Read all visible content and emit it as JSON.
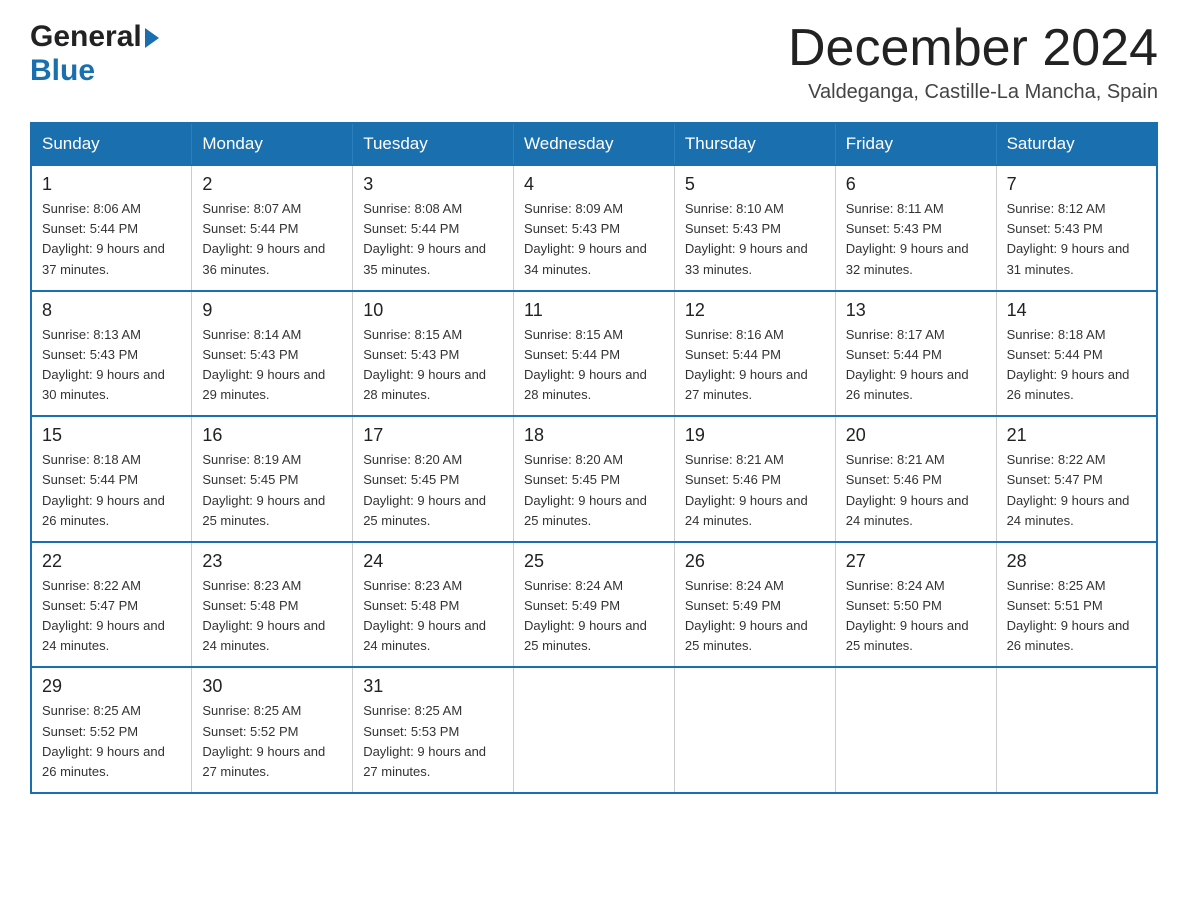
{
  "header": {
    "logo_general": "General",
    "logo_blue": "Blue",
    "month_title": "December 2024",
    "subtitle": "Valdeganga, Castille-La Mancha, Spain"
  },
  "weekdays": [
    "Sunday",
    "Monday",
    "Tuesday",
    "Wednesday",
    "Thursday",
    "Friday",
    "Saturday"
  ],
  "weeks": [
    [
      {
        "day": "1",
        "sunrise": "8:06 AM",
        "sunset": "5:44 PM",
        "daylight": "9 hours and 37 minutes."
      },
      {
        "day": "2",
        "sunrise": "8:07 AM",
        "sunset": "5:44 PM",
        "daylight": "9 hours and 36 minutes."
      },
      {
        "day": "3",
        "sunrise": "8:08 AM",
        "sunset": "5:44 PM",
        "daylight": "9 hours and 35 minutes."
      },
      {
        "day": "4",
        "sunrise": "8:09 AM",
        "sunset": "5:43 PM",
        "daylight": "9 hours and 34 minutes."
      },
      {
        "day": "5",
        "sunrise": "8:10 AM",
        "sunset": "5:43 PM",
        "daylight": "9 hours and 33 minutes."
      },
      {
        "day": "6",
        "sunrise": "8:11 AM",
        "sunset": "5:43 PM",
        "daylight": "9 hours and 32 minutes."
      },
      {
        "day": "7",
        "sunrise": "8:12 AM",
        "sunset": "5:43 PM",
        "daylight": "9 hours and 31 minutes."
      }
    ],
    [
      {
        "day": "8",
        "sunrise": "8:13 AM",
        "sunset": "5:43 PM",
        "daylight": "9 hours and 30 minutes."
      },
      {
        "day": "9",
        "sunrise": "8:14 AM",
        "sunset": "5:43 PM",
        "daylight": "9 hours and 29 minutes."
      },
      {
        "day": "10",
        "sunrise": "8:15 AM",
        "sunset": "5:43 PM",
        "daylight": "9 hours and 28 minutes."
      },
      {
        "day": "11",
        "sunrise": "8:15 AM",
        "sunset": "5:44 PM",
        "daylight": "9 hours and 28 minutes."
      },
      {
        "day": "12",
        "sunrise": "8:16 AM",
        "sunset": "5:44 PM",
        "daylight": "9 hours and 27 minutes."
      },
      {
        "day": "13",
        "sunrise": "8:17 AM",
        "sunset": "5:44 PM",
        "daylight": "9 hours and 26 minutes."
      },
      {
        "day": "14",
        "sunrise": "8:18 AM",
        "sunset": "5:44 PM",
        "daylight": "9 hours and 26 minutes."
      }
    ],
    [
      {
        "day": "15",
        "sunrise": "8:18 AM",
        "sunset": "5:44 PM",
        "daylight": "9 hours and 26 minutes."
      },
      {
        "day": "16",
        "sunrise": "8:19 AM",
        "sunset": "5:45 PM",
        "daylight": "9 hours and 25 minutes."
      },
      {
        "day": "17",
        "sunrise": "8:20 AM",
        "sunset": "5:45 PM",
        "daylight": "9 hours and 25 minutes."
      },
      {
        "day": "18",
        "sunrise": "8:20 AM",
        "sunset": "5:45 PM",
        "daylight": "9 hours and 25 minutes."
      },
      {
        "day": "19",
        "sunrise": "8:21 AM",
        "sunset": "5:46 PM",
        "daylight": "9 hours and 24 minutes."
      },
      {
        "day": "20",
        "sunrise": "8:21 AM",
        "sunset": "5:46 PM",
        "daylight": "9 hours and 24 minutes."
      },
      {
        "day": "21",
        "sunrise": "8:22 AM",
        "sunset": "5:47 PM",
        "daylight": "9 hours and 24 minutes."
      }
    ],
    [
      {
        "day": "22",
        "sunrise": "8:22 AM",
        "sunset": "5:47 PM",
        "daylight": "9 hours and 24 minutes."
      },
      {
        "day": "23",
        "sunrise": "8:23 AM",
        "sunset": "5:48 PM",
        "daylight": "9 hours and 24 minutes."
      },
      {
        "day": "24",
        "sunrise": "8:23 AM",
        "sunset": "5:48 PM",
        "daylight": "9 hours and 24 minutes."
      },
      {
        "day": "25",
        "sunrise": "8:24 AM",
        "sunset": "5:49 PM",
        "daylight": "9 hours and 25 minutes."
      },
      {
        "day": "26",
        "sunrise": "8:24 AM",
        "sunset": "5:49 PM",
        "daylight": "9 hours and 25 minutes."
      },
      {
        "day": "27",
        "sunrise": "8:24 AM",
        "sunset": "5:50 PM",
        "daylight": "9 hours and 25 minutes."
      },
      {
        "day": "28",
        "sunrise": "8:25 AM",
        "sunset": "5:51 PM",
        "daylight": "9 hours and 26 minutes."
      }
    ],
    [
      {
        "day": "29",
        "sunrise": "8:25 AM",
        "sunset": "5:52 PM",
        "daylight": "9 hours and 26 minutes."
      },
      {
        "day": "30",
        "sunrise": "8:25 AM",
        "sunset": "5:52 PM",
        "daylight": "9 hours and 27 minutes."
      },
      {
        "day": "31",
        "sunrise": "8:25 AM",
        "sunset": "5:53 PM",
        "daylight": "9 hours and 27 minutes."
      },
      null,
      null,
      null,
      null
    ]
  ]
}
